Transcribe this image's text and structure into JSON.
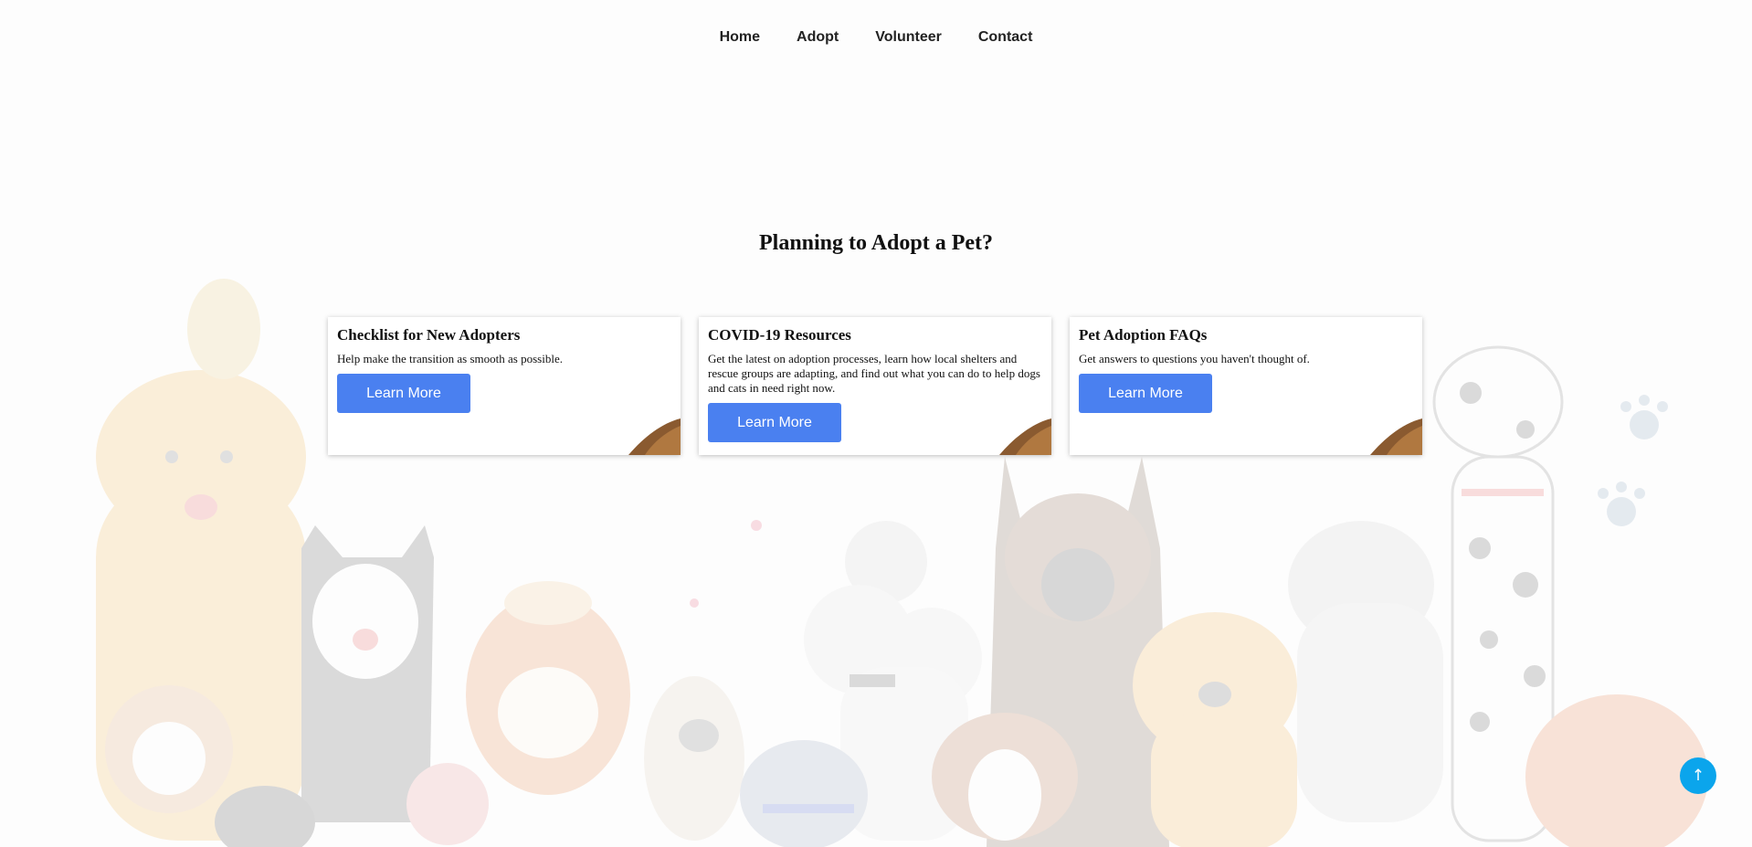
{
  "nav": {
    "items": [
      {
        "label": "Home"
      },
      {
        "label": "Adopt"
      },
      {
        "label": "Volunteer"
      },
      {
        "label": "Contact"
      }
    ]
  },
  "main": {
    "title": "Planning to Adopt a Pet?",
    "cards": [
      {
        "title": "Checklist for New Adopters",
        "text": "Help make the transition as smooth as possible.",
        "button": "Learn More"
      },
      {
        "title": "COVID-19 Resources",
        "text": "Get the latest on adoption processes, learn how local shelters and rescue groups are adapting, and find out what you can do to help dogs and cats in need right now.",
        "button": "Learn More"
      },
      {
        "title": "Pet Adoption FAQs",
        "text": "Get answers to questions you haven't thought of.",
        "button": "Learn More"
      }
    ]
  },
  "back_to_top": {
    "label": "↑"
  },
  "colors": {
    "button": "#4a80f0",
    "back_to_top": "#0ba5ec",
    "background": "#fdfdfd"
  },
  "icons": {
    "back_to_top": "arrow-up-icon",
    "background": "pets-illustration"
  }
}
